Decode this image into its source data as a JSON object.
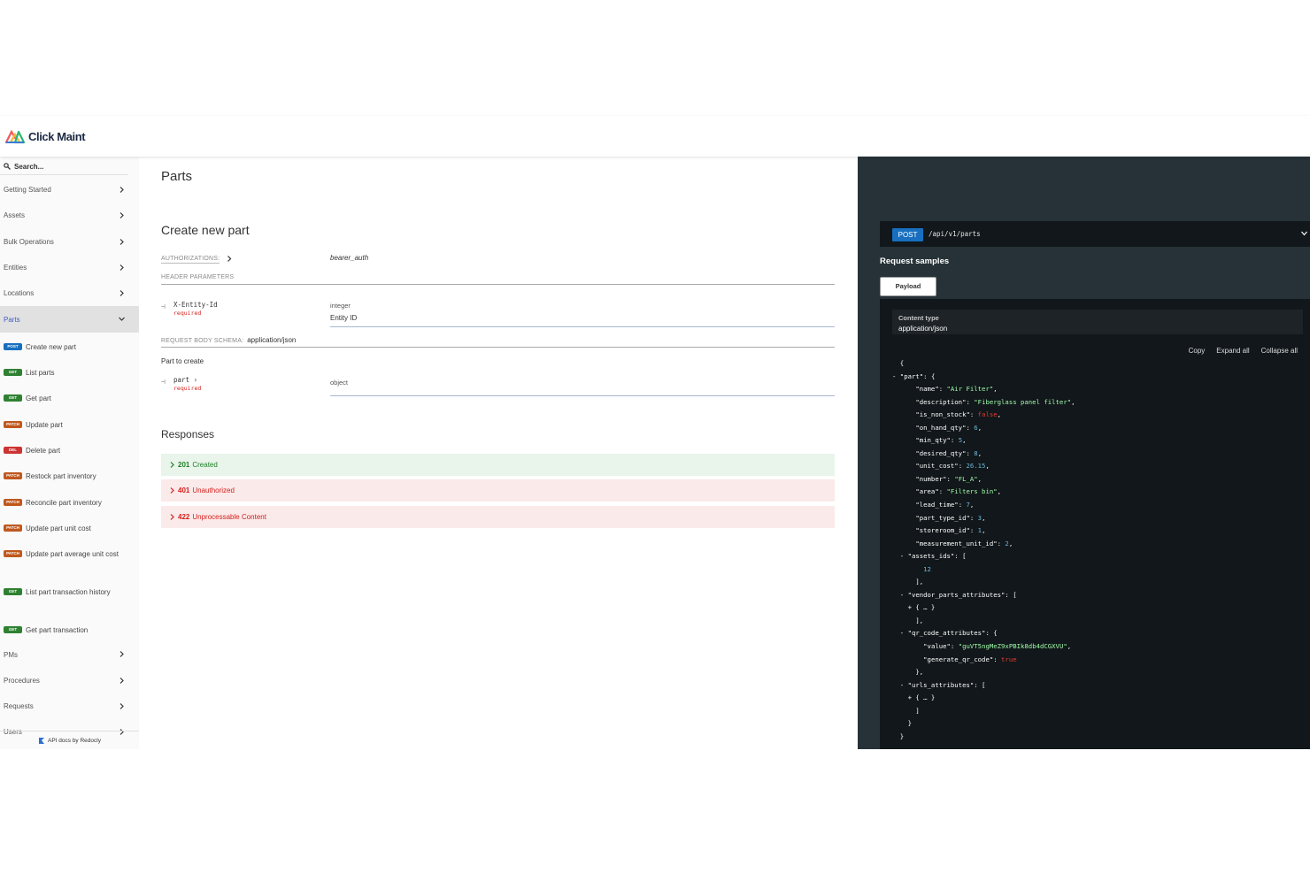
{
  "brand": {
    "name": "Click Maint"
  },
  "search": {
    "placeholder": "Search..."
  },
  "sidebar": {
    "sections_top": [
      "Getting Started",
      "Assets",
      "Bulk Operations",
      "Entities",
      "Locations"
    ],
    "active_section": "Parts",
    "sub_items": [
      {
        "method": "POST",
        "label": "Create new part"
      },
      {
        "method": "GET",
        "label": "List parts"
      },
      {
        "method": "GET",
        "label": "Get part"
      },
      {
        "method": "PATCH",
        "label": "Update part"
      },
      {
        "method": "DEL",
        "label": "Delete part"
      },
      {
        "method": "PATCH",
        "label": "Restock part inventory"
      },
      {
        "method": "PATCH",
        "label": "Reconcile part inventory"
      },
      {
        "method": "PATCH",
        "label": "Update part unit cost"
      },
      {
        "method": "PATCH",
        "label": "Update part average unit cost"
      },
      {
        "method": "GET",
        "label": "List part transaction history"
      },
      {
        "method": "GET",
        "label": "Get part transaction"
      }
    ],
    "sections_bottom": [
      "PMs",
      "Procedures",
      "Requests",
      "Users"
    ],
    "footer": "API docs by Redocly"
  },
  "main": {
    "section_title": "Parts",
    "operation_title": "Create new part",
    "authorizations_label": "AUTHORIZATIONS:",
    "authorizations_value": "bearer_auth",
    "header_params_label": "HEADER PARAMETERS",
    "header_param": {
      "name": "X-Entity-Id",
      "required": "required",
      "type": "integer",
      "description": "Entity ID"
    },
    "body_schema_label": "REQUEST BODY SCHEMA:",
    "body_schema_value": "application/json",
    "body_description": "Part to create",
    "body_param": {
      "name": "part",
      "required": "required",
      "type": "object"
    },
    "responses_title": "Responses",
    "responses": [
      {
        "code": "201",
        "text": "Created",
        "status": "ok"
      },
      {
        "code": "401",
        "text": "Unauthorized",
        "status": "err"
      },
      {
        "code": "422",
        "text": "Unprocessable Content",
        "status": "err"
      }
    ]
  },
  "right": {
    "method": "POST",
    "path": "/api/v1/parts",
    "request_samples_title": "Request samples",
    "tab": "Payload",
    "content_type_label": "Content type",
    "content_type_value": "application/json",
    "actions": [
      "Copy",
      "Expand all",
      "Collapse all"
    ],
    "json_lines": [
      {
        "indent": 0,
        "text": [
          {
            "t": "{",
            "c": "p"
          }
        ]
      },
      {
        "indent": 0,
        "toggle": "-",
        "text": [
          {
            "t": "\"part\"",
            "c": "k"
          },
          {
            "t": ": {",
            "c": "p"
          }
        ]
      },
      {
        "indent": 2,
        "text": [
          {
            "t": "\"name\"",
            "c": "k"
          },
          {
            "t": ": ",
            "c": "p"
          },
          {
            "t": "\"Air Filter\"",
            "c": "s"
          },
          {
            "t": ",",
            "c": "p"
          }
        ]
      },
      {
        "indent": 2,
        "text": [
          {
            "t": "\"description\"",
            "c": "k"
          },
          {
            "t": ": ",
            "c": "p"
          },
          {
            "t": "\"Fiberglass panel filter\"",
            "c": "s"
          },
          {
            "t": ",",
            "c": "p"
          }
        ]
      },
      {
        "indent": 2,
        "text": [
          {
            "t": "\"is_non_stock\"",
            "c": "k"
          },
          {
            "t": ": ",
            "c": "p"
          },
          {
            "t": "false",
            "c": "b"
          },
          {
            "t": ",",
            "c": "p"
          }
        ]
      },
      {
        "indent": 2,
        "text": [
          {
            "t": "\"on_hand_qty\"",
            "c": "k"
          },
          {
            "t": ": ",
            "c": "p"
          },
          {
            "t": "6",
            "c": "n"
          },
          {
            "t": ",",
            "c": "p"
          }
        ]
      },
      {
        "indent": 2,
        "text": [
          {
            "t": "\"min_qty\"",
            "c": "k"
          },
          {
            "t": ": ",
            "c": "p"
          },
          {
            "t": "5",
            "c": "n"
          },
          {
            "t": ",",
            "c": "p"
          }
        ]
      },
      {
        "indent": 2,
        "text": [
          {
            "t": "\"desired_qty\"",
            "c": "k"
          },
          {
            "t": ": ",
            "c": "p"
          },
          {
            "t": "8",
            "c": "n"
          },
          {
            "t": ",",
            "c": "p"
          }
        ]
      },
      {
        "indent": 2,
        "text": [
          {
            "t": "\"unit_cost\"",
            "c": "k"
          },
          {
            "t": ": ",
            "c": "p"
          },
          {
            "t": "26.15",
            "c": "n"
          },
          {
            "t": ",",
            "c": "p"
          }
        ]
      },
      {
        "indent": 2,
        "text": [
          {
            "t": "\"number\"",
            "c": "k"
          },
          {
            "t": ": ",
            "c": "p"
          },
          {
            "t": "\"FL_A\"",
            "c": "s"
          },
          {
            "t": ",",
            "c": "p"
          }
        ]
      },
      {
        "indent": 2,
        "text": [
          {
            "t": "\"area\"",
            "c": "k"
          },
          {
            "t": ": ",
            "c": "p"
          },
          {
            "t": "\"Filters bin\"",
            "c": "s"
          },
          {
            "t": ",",
            "c": "p"
          }
        ]
      },
      {
        "indent": 2,
        "text": [
          {
            "t": "\"lead_time\"",
            "c": "k"
          },
          {
            "t": ": ",
            "c": "p"
          },
          {
            "t": "7",
            "c": "n"
          },
          {
            "t": ",",
            "c": "p"
          }
        ]
      },
      {
        "indent": 2,
        "text": [
          {
            "t": "\"part_type_id\"",
            "c": "k"
          },
          {
            "t": ": ",
            "c": "p"
          },
          {
            "t": "3",
            "c": "n"
          },
          {
            "t": ",",
            "c": "p"
          }
        ]
      },
      {
        "indent": 2,
        "text": [
          {
            "t": "\"storeroom_id\"",
            "c": "k"
          },
          {
            "t": ": ",
            "c": "p"
          },
          {
            "t": "1",
            "c": "n"
          },
          {
            "t": ",",
            "c": "p"
          }
        ]
      },
      {
        "indent": 2,
        "text": [
          {
            "t": "\"measurement_unit_id\"",
            "c": "k"
          },
          {
            "t": ": ",
            "c": "p"
          },
          {
            "t": "2",
            "c": "n"
          },
          {
            "t": ",",
            "c": "p"
          }
        ]
      },
      {
        "indent": 1,
        "toggle": "-",
        "text": [
          {
            "t": "\"assets_ids\"",
            "c": "k"
          },
          {
            "t": ": [",
            "c": "p"
          }
        ]
      },
      {
        "indent": 3,
        "text": [
          {
            "t": "12",
            "c": "n"
          }
        ]
      },
      {
        "indent": 2,
        "text": [
          {
            "t": "],",
            "c": "p"
          }
        ]
      },
      {
        "indent": 1,
        "toggle": "-",
        "text": [
          {
            "t": "\"vendor_parts_attributes\"",
            "c": "k"
          },
          {
            "t": ": [",
            "c": "p"
          }
        ]
      },
      {
        "indent": 2,
        "toggle": "+",
        "text": [
          {
            "t": "{ … }",
            "c": "p"
          }
        ]
      },
      {
        "indent": 2,
        "text": [
          {
            "t": "],",
            "c": "p"
          }
        ]
      },
      {
        "indent": 1,
        "toggle": "-",
        "text": [
          {
            "t": "\"qr_code_attributes\"",
            "c": "k"
          },
          {
            "t": ": {",
            "c": "p"
          }
        ]
      },
      {
        "indent": 3,
        "text": [
          {
            "t": "\"value\"",
            "c": "k"
          },
          {
            "t": ": ",
            "c": "p"
          },
          {
            "t": "\"guVT5ngMeZ9xPBIk8db4dCGXVU\"",
            "c": "s"
          },
          {
            "t": ",",
            "c": "p"
          }
        ]
      },
      {
        "indent": 3,
        "text": [
          {
            "t": "\"generate_qr_code\"",
            "c": "k"
          },
          {
            "t": ": ",
            "c": "p"
          },
          {
            "t": "true",
            "c": "b"
          }
        ]
      },
      {
        "indent": 2,
        "text": [
          {
            "t": "},",
            "c": "p"
          }
        ]
      },
      {
        "indent": 1,
        "toggle": "-",
        "text": [
          {
            "t": "\"urls_attributes\"",
            "c": "k"
          },
          {
            "t": ": [",
            "c": "p"
          }
        ]
      },
      {
        "indent": 2,
        "toggle": "+",
        "text": [
          {
            "t": "{ … }",
            "c": "p"
          }
        ]
      },
      {
        "indent": 2,
        "text": [
          {
            "t": "]",
            "c": "p"
          }
        ]
      },
      {
        "indent": 1,
        "text": [
          {
            "t": "}",
            "c": "p"
          }
        ]
      },
      {
        "indent": 0,
        "text": [
          {
            "t": "}",
            "c": "p"
          }
        ]
      }
    ]
  },
  "colors": {
    "post": "#186fbf",
    "get": "#2f8132",
    "patch": "#bf581d",
    "del": "#cc3333",
    "panel_dark": "#263238",
    "code_bg": "#11171a",
    "string": "#a0fbaa",
    "number": "#6ab7d9",
    "boolean": "#e53935"
  }
}
